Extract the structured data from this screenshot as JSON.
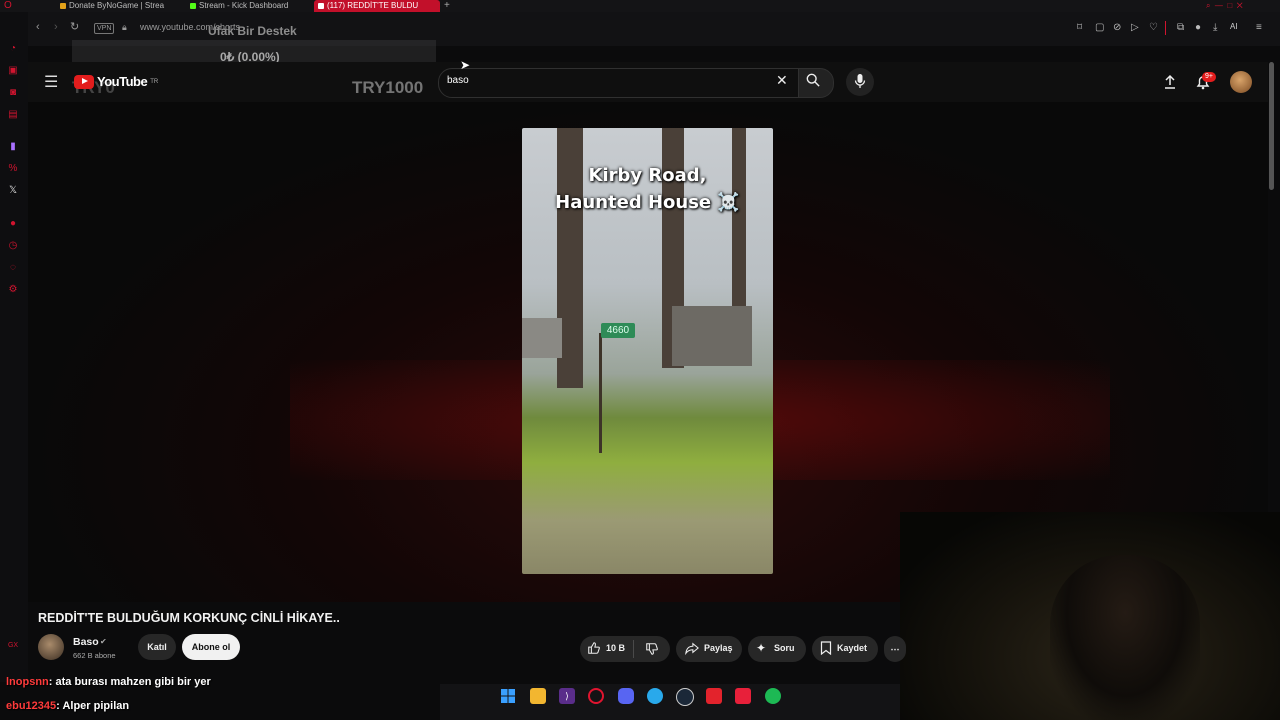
{
  "browser": {
    "tabs": [
      {
        "label": "Donate ByNoGame | Strea",
        "icon_color": "#e3a21a"
      },
      {
        "label": "Stream - Kick Dashboard",
        "icon_color": "#53fc18"
      },
      {
        "label": "(117) REDDİT'TE BULDU",
        "icon_color": "#ffffff"
      }
    ],
    "vpn_label": "VPN",
    "url": "www.youtube.com/shorts",
    "ai_label": "AI"
  },
  "overlay": {
    "donate_title": "Ufak Bir Destek",
    "donate_amount": "0₺ (0.00%)",
    "ghost_left": "TRY0",
    "ghost_right": "TRY1000"
  },
  "youtube": {
    "logo_text": "YouTube",
    "logo_region": "TR",
    "search_value": "baso",
    "notification_count": "9+"
  },
  "video": {
    "caption_line1": "Kirby Road,",
    "caption_line2": "Haunted House ☠️",
    "sign_number": "4660",
    "title": "REDDİT'TE BULDUĞUM KORKUNÇ CİNLİ HİKAYE..",
    "channel_name": "Baso",
    "subscribers": "662 B abone",
    "join_label": "Katıl",
    "subscribe_label": "Abone ol",
    "likes": "10 B",
    "share_label": "Paylaş",
    "ask_label": "Soru",
    "save_label": "Kaydet"
  },
  "chat": [
    {
      "user": "lnopsnn",
      "message": ": ata burası mahzen gibi bir yer"
    },
    {
      "user": "ebu12345",
      "message": ": Alper pipilan"
    }
  ],
  "colors": {
    "accent_red": "#e31d1d",
    "opera_red": "#d0142f",
    "chat_user": "#ff3b3b"
  }
}
